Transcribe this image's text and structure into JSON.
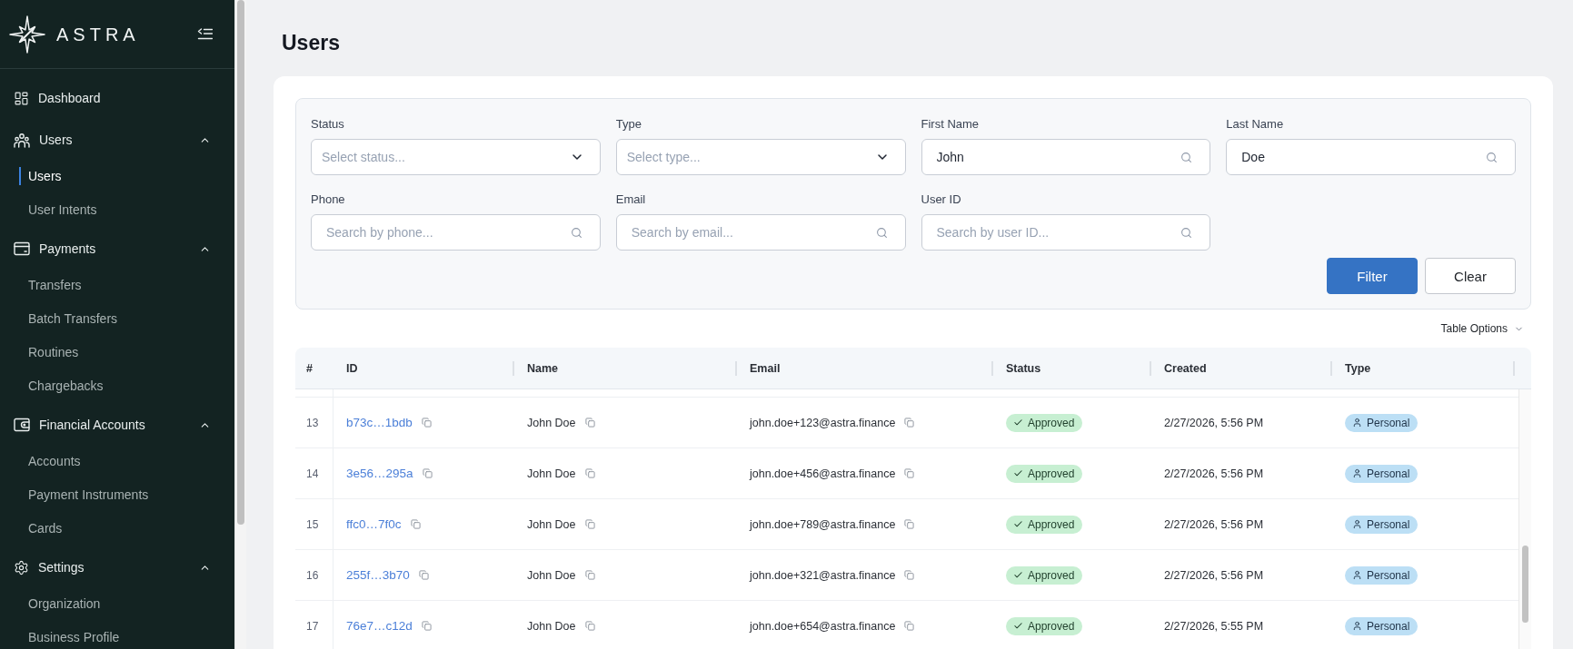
{
  "sidebar": {
    "brand": "ASTRA",
    "nav": [
      {
        "kind": "link",
        "label": "Dashboard"
      },
      {
        "kind": "group",
        "label": "Users",
        "expanded": true,
        "children": [
          {
            "label": "Users",
            "selected": true
          },
          {
            "label": "User Intents",
            "selected": false
          }
        ]
      },
      {
        "kind": "group",
        "label": "Payments",
        "expanded": true,
        "children": [
          {
            "label": "Transfers",
            "selected": false
          },
          {
            "label": "Batch Transfers",
            "selected": false
          },
          {
            "label": "Routines",
            "selected": false
          },
          {
            "label": "Chargebacks",
            "selected": false
          }
        ]
      },
      {
        "kind": "group",
        "label": "Financial Accounts",
        "expanded": true,
        "children": [
          {
            "label": "Accounts",
            "selected": false
          },
          {
            "label": "Payment Instruments",
            "selected": false
          },
          {
            "label": "Cards",
            "selected": false
          }
        ]
      },
      {
        "kind": "group",
        "label": "Settings",
        "expanded": true,
        "children": [
          {
            "label": "Organization",
            "selected": false
          },
          {
            "label": "Business Profile",
            "selected": false
          }
        ]
      }
    ]
  },
  "page": {
    "title": "Users"
  },
  "filters": {
    "fields": [
      {
        "kind": "select",
        "label": "Status",
        "placeholder": "Select status..."
      },
      {
        "kind": "select",
        "label": "Type",
        "placeholder": "Select type..."
      },
      {
        "kind": "search",
        "label": "First Name",
        "value": "John"
      },
      {
        "kind": "search",
        "label": "Last Name",
        "value": "Doe"
      },
      {
        "kind": "search",
        "label": "Phone",
        "placeholder": "Search by phone..."
      },
      {
        "kind": "search",
        "label": "Email",
        "placeholder": "Search by email..."
      },
      {
        "kind": "search",
        "label": "User ID",
        "placeholder": "Search by user ID..."
      }
    ],
    "buttons": [
      {
        "kind": "primary",
        "label": "Filter"
      },
      {
        "kind": "secondary",
        "label": "Clear"
      }
    ]
  },
  "table_options": {
    "label": "Table Options"
  },
  "table": {
    "columns": [
      "#",
      "ID",
      "Name",
      "Email",
      "Status",
      "Created",
      "Type"
    ],
    "rows": [
      {
        "number": "13",
        "id": "b73c…1bdb",
        "name": "John Doe",
        "email": "john.doe+123@astra.finance",
        "status": "Approved",
        "created": "2/27/2026, 5:56 PM",
        "type": "Personal"
      },
      {
        "number": "14",
        "id": "3e56…295a",
        "name": "John Doe",
        "email": "john.doe+456@astra.finance",
        "status": "Approved",
        "created": "2/27/2026, 5:56 PM",
        "type": "Personal"
      },
      {
        "number": "15",
        "id": "ffc0…7f0c",
        "name": "John Doe",
        "email": "john.doe+789@astra.finance",
        "status": "Approved",
        "created": "2/27/2026, 5:56 PM",
        "type": "Personal"
      },
      {
        "number": "16",
        "id": "255f…3b70",
        "name": "John Doe",
        "email": "john.doe+321@astra.finance",
        "status": "Approved",
        "created": "2/27/2026, 5:56 PM",
        "type": "Personal"
      },
      {
        "number": "17",
        "id": "76e7…c12d",
        "name": "John Doe",
        "email": "john.doe+654@astra.finance",
        "status": "Approved",
        "created": "2/27/2026, 5:55 PM",
        "type": "Personal"
      }
    ]
  }
}
